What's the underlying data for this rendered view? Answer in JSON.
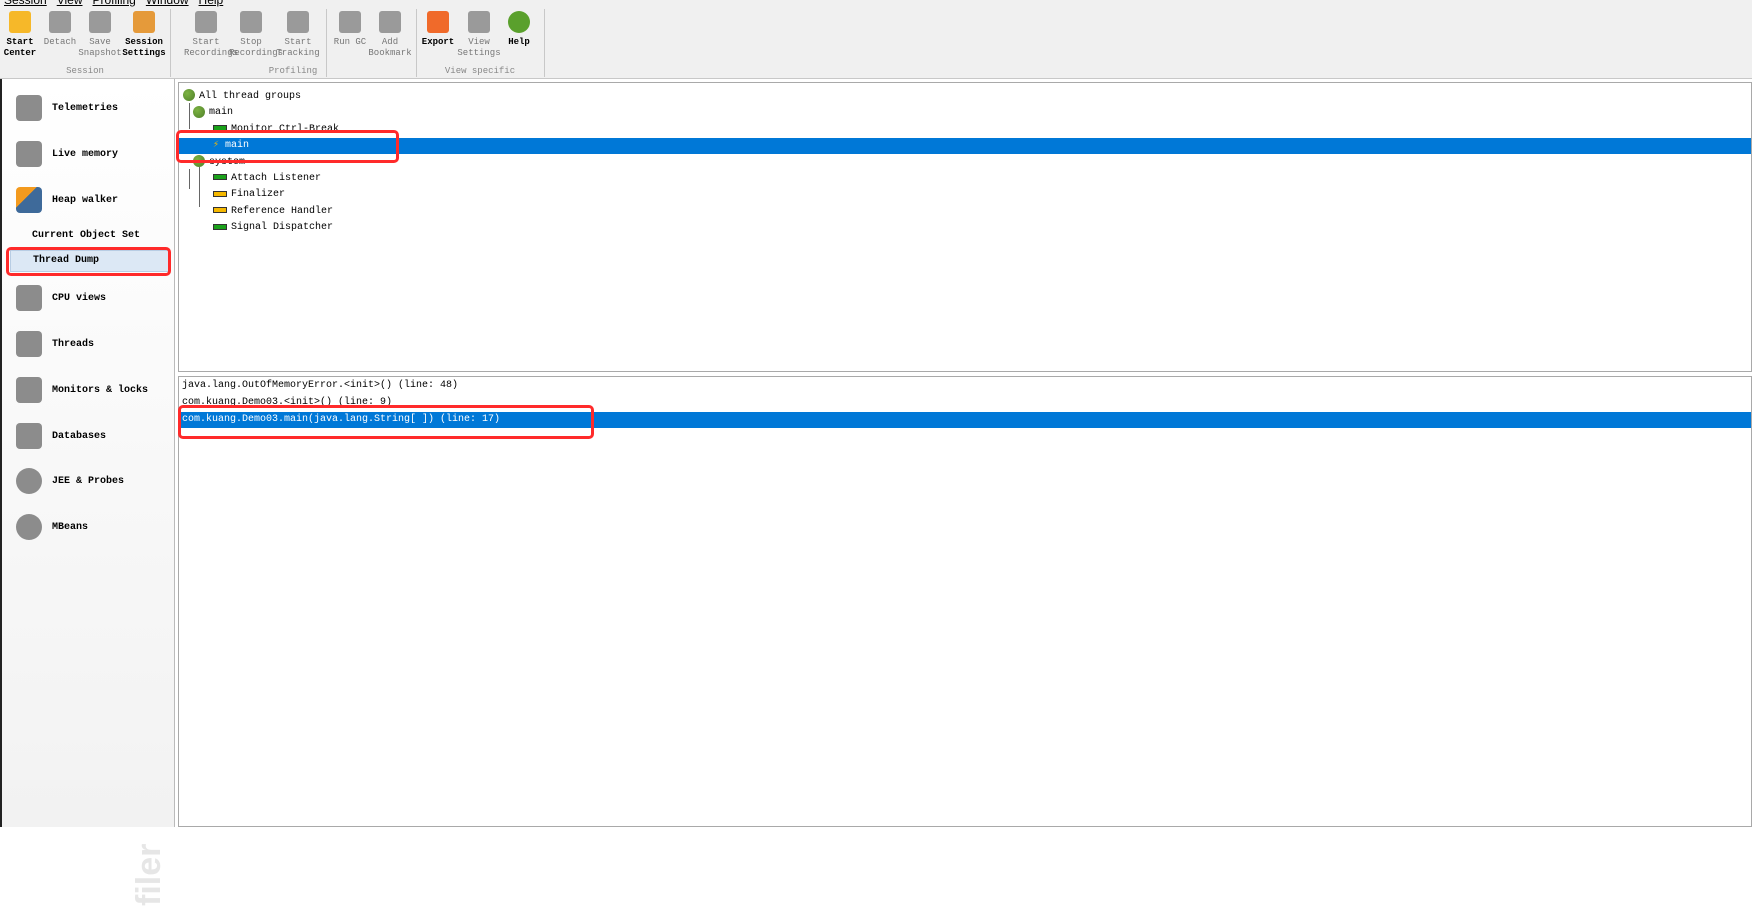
{
  "menu": [
    "Session",
    "View",
    "Profiling",
    "Window",
    "Help"
  ],
  "toolbar": {
    "groups": [
      {
        "label": "Session"
      },
      {
        "label": "Profiling"
      },
      {
        "label": "View specific"
      }
    ],
    "buttons": [
      {
        "label": "Start Center",
        "icon": "folder-play-icon",
        "enabled": true
      },
      {
        "label": "Detach",
        "icon": "plug-icon",
        "enabled": false
      },
      {
        "label": "Save Snapshot",
        "icon": "floppy-icon",
        "enabled": false
      },
      {
        "label": "Session Settings",
        "icon": "clipboard-edit-icon",
        "enabled": true
      },
      {
        "label": "Start Recordings",
        "icon": "record-icon",
        "enabled": false
      },
      {
        "label": "Stop Recordings",
        "icon": "stop-record-icon",
        "enabled": false
      },
      {
        "label": "Start Tracking",
        "icon": "tracking-icon",
        "enabled": false
      },
      {
        "label": "Run GC",
        "icon": "recycle-icon",
        "enabled": false
      },
      {
        "label": "Add Bookmark",
        "icon": "bookmark-icon",
        "enabled": false
      },
      {
        "label": "Export",
        "icon": "export-arrow-icon",
        "enabled": true
      },
      {
        "label": "View Settings",
        "icon": "view-settings-icon",
        "enabled": false
      },
      {
        "label": "Help",
        "icon": "help-icon",
        "enabled": true
      }
    ]
  },
  "sidebar": {
    "items": [
      {
        "label": "Telemetries",
        "icon": "telemetry-chart-icon"
      },
      {
        "label": "Live memory",
        "icon": "cubes-icon"
      },
      {
        "label": "Heap walker",
        "icon": "camera-icon"
      },
      {
        "label": "Current Object Set",
        "sub": true
      },
      {
        "label": "Thread Dump",
        "sub": true,
        "selected": true
      },
      {
        "label": "CPU views",
        "icon": "chip-icon"
      },
      {
        "label": "Threads",
        "icon": "spool-icon"
      },
      {
        "label": "Monitors & locks",
        "icon": "padlock-icon"
      },
      {
        "label": "Databases",
        "icon": "database-icon"
      },
      {
        "label": "JEE & Probes",
        "icon": "gauge-icon"
      },
      {
        "label": "MBeans",
        "icon": "globe-icon"
      }
    ],
    "watermark": "filer"
  },
  "thread_tree": [
    {
      "label": "All thread groups",
      "type": "group",
      "depth": 0
    },
    {
      "label": "main",
      "type": "group",
      "depth": 1
    },
    {
      "label": "Monitor Ctrl-Break",
      "type": "thread",
      "state": "running",
      "depth": 2
    },
    {
      "label": "main",
      "type": "thread",
      "state": "current",
      "depth": 2,
      "selected": true
    },
    {
      "label": "system",
      "type": "group",
      "depth": 1
    },
    {
      "label": "Attach Listener",
      "type": "thread",
      "state": "running",
      "depth": 2
    },
    {
      "label": "Finalizer",
      "type": "thread",
      "state": "waiting",
      "depth": 2
    },
    {
      "label": "Reference Handler",
      "type": "thread",
      "state": "waiting",
      "depth": 2
    },
    {
      "label": "Signal Dispatcher",
      "type": "thread",
      "state": "running",
      "depth": 2
    }
  ],
  "stack_trace": [
    {
      "label": "java.lang.OutOfMemoryError.<init>() (line: 48)"
    },
    {
      "label": "com.kuang.Demo03.<init>() (line: 9)"
    },
    {
      "label": "com.kuang.Demo03.main(java.lang.String[ ]) (line: 17)",
      "selected": true
    }
  ],
  "colors": {
    "selection": "#0078d7",
    "highlight_box": "#ff2a2a",
    "running": "#1aa11a",
    "waiting": "#f5b800"
  }
}
